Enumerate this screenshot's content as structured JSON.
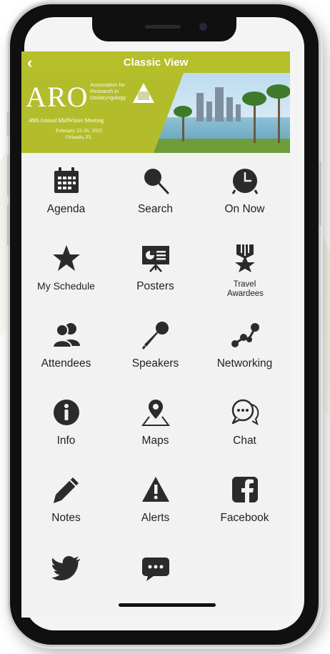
{
  "header": {
    "title": "Classic View",
    "back_icon": "chevron-left-icon"
  },
  "banner": {
    "logo": "ARO",
    "association": [
      "Association for",
      "Research in",
      "Otolaryngology"
    ],
    "meeting": "48th Annual MidWinter Meeting",
    "dates": "February 22-26, 2025",
    "location": "Orlando, FL"
  },
  "colors": {
    "accent": "#b5bf2a",
    "icon": "#2b2b2b",
    "background": "#f2f2f2"
  },
  "menu": [
    {
      "label": "Agenda",
      "icon": "calendar-icon"
    },
    {
      "label": "Search",
      "icon": "magnifier-icon"
    },
    {
      "label": "On Now",
      "icon": "clock-icon"
    },
    {
      "label": "My Schedule",
      "icon": "star-icon"
    },
    {
      "label": "Posters",
      "icon": "presentation-board-icon"
    },
    {
      "label": "Travel Awardees",
      "icon": "award-ribbon-icon"
    },
    {
      "label": "Attendees",
      "icon": "users-icon"
    },
    {
      "label": "Speakers",
      "icon": "microphone-icon"
    },
    {
      "label": "Networking",
      "icon": "network-icon"
    },
    {
      "label": "Info",
      "icon": "info-icon"
    },
    {
      "label": "Maps",
      "icon": "map-pin-icon"
    },
    {
      "label": "Chat",
      "icon": "chat-bubbles-icon"
    },
    {
      "label": "Notes",
      "icon": "pencil-icon"
    },
    {
      "label": "Alerts",
      "icon": "warning-icon"
    },
    {
      "label": "Facebook",
      "icon": "facebook-icon"
    },
    {
      "label": "",
      "icon": "twitter-bird-icon"
    },
    {
      "label": "",
      "icon": "message-bubble-icon"
    }
  ]
}
